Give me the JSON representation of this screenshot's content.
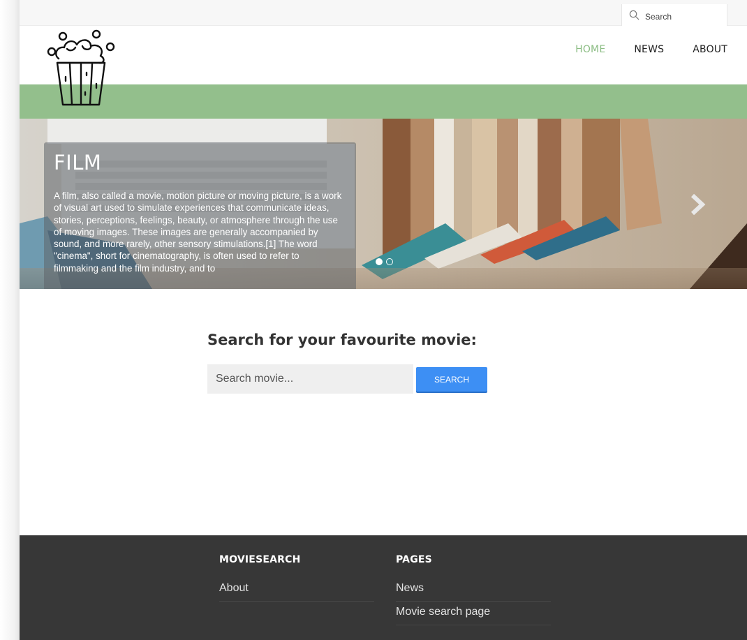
{
  "topbar": {
    "search_label": "Search"
  },
  "nav": {
    "items": [
      {
        "label": "HOME",
        "active": true
      },
      {
        "label": "NEWS"
      },
      {
        "label": "ABOUT"
      }
    ]
  },
  "colors": {
    "accent_green": "#93bf8c",
    "nav_active": "#8cbd84",
    "button_blue": "#3d8ff4",
    "footer_bg": "#373737"
  },
  "hero": {
    "title": "FILM",
    "text": "A film, also called a movie, motion picture or moving picture, is a work of visual art used to simulate experiences that communicate ideas, stories, perceptions, feelings, beauty, or atmosphere through the use of moving images. These images are generally accompanied by sound, and more rarely, other sensory stimulations.[1] The word \"cinema\", short for cinematography, is often used to refer to filmmaking and the film industry, and to",
    "slide_count": 2,
    "active_slide": 1
  },
  "search": {
    "title": "Search for your favourite movie:",
    "placeholder": "Search movie...",
    "button_label": "SEARCH"
  },
  "footer": {
    "col1": {
      "heading": "MOVIESEARCH",
      "links": [
        "About"
      ]
    },
    "col2": {
      "heading": "PAGES",
      "links": [
        "News",
        "Movie search page"
      ]
    }
  },
  "icons": [
    "search-icon",
    "popcorn-logo-icon",
    "chevron-right-icon"
  ]
}
